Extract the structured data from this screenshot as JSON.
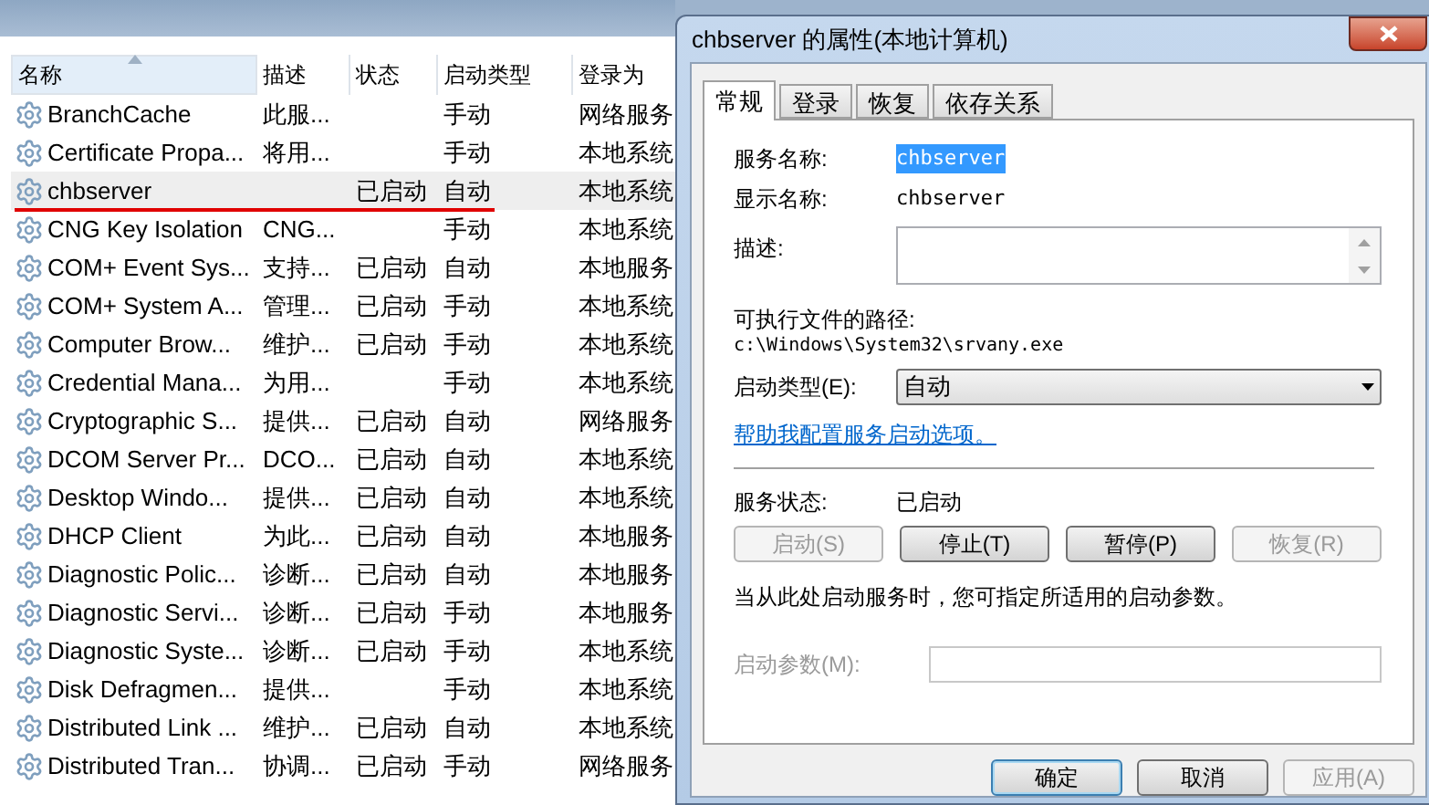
{
  "services": {
    "columns": [
      {
        "label": "名称",
        "sorted": true
      },
      {
        "label": "描述",
        "sorted": false
      },
      {
        "label": "状态",
        "sorted": false
      },
      {
        "label": "启动类型",
        "sorted": false
      },
      {
        "label": "登录为",
        "sorted": false
      }
    ],
    "rows": [
      {
        "name": "BranchCache",
        "description": "此服...",
        "status": "",
        "startup": "手动",
        "logon": "网络服务",
        "selected": false,
        "underlined": false
      },
      {
        "name": "Certificate Propa...",
        "description": "将用...",
        "status": "",
        "startup": "手动",
        "logon": "本地系统",
        "selected": false,
        "underlined": false
      },
      {
        "name": "chbserver",
        "description": "",
        "status": "已启动",
        "startup": "自动",
        "logon": "本地系统",
        "selected": true,
        "underlined": true
      },
      {
        "name": "CNG Key Isolation",
        "description": "CNG...",
        "status": "",
        "startup": "手动",
        "logon": "本地系统",
        "selected": false,
        "underlined": false
      },
      {
        "name": "COM+ Event Sys...",
        "description": "支持...",
        "status": "已启动",
        "startup": "自动",
        "logon": "本地服务",
        "selected": false,
        "underlined": false
      },
      {
        "name": "COM+ System A...",
        "description": "管理...",
        "status": "已启动",
        "startup": "手动",
        "logon": "本地系统",
        "selected": false,
        "underlined": false
      },
      {
        "name": "Computer Brow...",
        "description": "维护...",
        "status": "已启动",
        "startup": "手动",
        "logon": "本地系统",
        "selected": false,
        "underlined": false
      },
      {
        "name": "Credential Mana...",
        "description": "为用...",
        "status": "",
        "startup": "手动",
        "logon": "本地系统",
        "selected": false,
        "underlined": false
      },
      {
        "name": "Cryptographic S...",
        "description": "提供...",
        "status": "已启动",
        "startup": "自动",
        "logon": "网络服务",
        "selected": false,
        "underlined": false
      },
      {
        "name": "DCOM Server Pr...",
        "description": "DCO...",
        "status": "已启动",
        "startup": "自动",
        "logon": "本地系统",
        "selected": false,
        "underlined": false
      },
      {
        "name": "Desktop Windo...",
        "description": "提供...",
        "status": "已启动",
        "startup": "自动",
        "logon": "本地系统",
        "selected": false,
        "underlined": false
      },
      {
        "name": "DHCP Client",
        "description": "为此...",
        "status": "已启动",
        "startup": "自动",
        "logon": "本地服务",
        "selected": false,
        "underlined": false
      },
      {
        "name": "Diagnostic Polic...",
        "description": "诊断...",
        "status": "已启动",
        "startup": "自动",
        "logon": "本地服务",
        "selected": false,
        "underlined": false
      },
      {
        "name": "Diagnostic Servi...",
        "description": "诊断...",
        "status": "已启动",
        "startup": "手动",
        "logon": "本地服务",
        "selected": false,
        "underlined": false
      },
      {
        "name": "Diagnostic Syste...",
        "description": "诊断...",
        "status": "已启动",
        "startup": "手动",
        "logon": "本地系统",
        "selected": false,
        "underlined": false
      },
      {
        "name": "Disk Defragmen...",
        "description": "提供...",
        "status": "",
        "startup": "手动",
        "logon": "本地系统",
        "selected": false,
        "underlined": false
      },
      {
        "name": "Distributed Link ...",
        "description": "维护...",
        "status": "已启动",
        "startup": "自动",
        "logon": "本地系统",
        "selected": false,
        "underlined": false
      },
      {
        "name": "Distributed Tran...",
        "description": "协调...",
        "status": "已启动",
        "startup": "手动",
        "logon": "网络服务",
        "selected": false,
        "underlined": false
      }
    ]
  },
  "dialog": {
    "title": "chbserver 的属性(本地计算机)",
    "tabs": [
      {
        "label": "常规",
        "selected": true
      },
      {
        "label": "登录",
        "selected": false
      },
      {
        "label": "恢复",
        "selected": false
      },
      {
        "label": "依存关系",
        "selected": false
      }
    ],
    "service_name": {
      "label": "服务名称:",
      "value": "chbserver",
      "highlighted": true
    },
    "display_name": {
      "label": "显示名称:",
      "value": "chbserver"
    },
    "description": {
      "label": "描述:"
    },
    "path": {
      "label": "可执行文件的路径:",
      "value": "c:\\Windows\\System32\\srvany.exe"
    },
    "startup_type": {
      "label": "启动类型(E):",
      "value": "自动"
    },
    "help_link": "帮助我配置服务启动选项。",
    "service_status": {
      "label": "服务状态:",
      "value": "已启动"
    },
    "control_buttons": [
      {
        "label": "启动(S)",
        "disabled": true
      },
      {
        "label": "停止(T)",
        "disabled": false
      },
      {
        "label": "暂停(P)",
        "disabled": false
      },
      {
        "label": "恢复(R)",
        "disabled": true
      }
    ],
    "hint": "当从此处启动服务时，您可指定所适用的启动参数。",
    "start_params": {
      "label": "启动参数(M):",
      "disabled": true
    },
    "footer_buttons": [
      {
        "label": "确定",
        "disabled": false,
        "default": true
      },
      {
        "label": "取消",
        "disabled": false,
        "default": false
      },
      {
        "label": "应用(A)",
        "disabled": true,
        "default": false
      }
    ]
  }
}
